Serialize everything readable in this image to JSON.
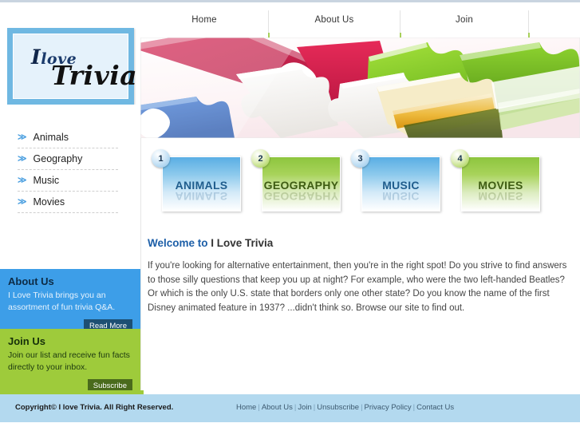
{
  "nav": {
    "items": [
      {
        "label": "Home"
      },
      {
        "label": "About Us"
      },
      {
        "label": "Join"
      }
    ]
  },
  "logo": {
    "line1_i": "I",
    "line1_love": "love",
    "line2": "Trivia"
  },
  "sidebar": {
    "menu": [
      {
        "label": "Animals",
        "bullet": "≫"
      },
      {
        "label": "Geography",
        "bullet": "≫"
      },
      {
        "label": "Music",
        "bullet": "≫"
      },
      {
        "label": "Movies",
        "bullet": "≫"
      }
    ],
    "about": {
      "title": "About Us",
      "text": "I Love Trivia brings you an assortment of fun trivia Q&A.",
      "button": "Read More"
    },
    "join": {
      "title": "Join Us",
      "text": "Join our list and receive fun facts directly to your inbox.",
      "button": "Subscribe"
    }
  },
  "cards": [
    {
      "number": "1",
      "label": "ANIMALS",
      "color": "blue"
    },
    {
      "number": "2",
      "label": "GEOGRAPHY",
      "color": "green"
    },
    {
      "number": "3",
      "label": "MUSIC",
      "color": "blue"
    },
    {
      "number": "4",
      "label": "MOVIES",
      "color": "green"
    }
  ],
  "welcome": {
    "heading_accent": "Welcome to ",
    "heading_rest": "I Love Trivia",
    "body": "If you're looking for alternative entertainment, then you're in the right spot! Do you strive to find answers to those silly questions that keep you up at night? For example, who were the two left-handed Beatles? Or which is the only U.S. state that borders only one other state? Do you know the name of the first Disney animated feature in 1937? ...didn't think so. Browse our site to find out."
  },
  "footer": {
    "copyright": "Copyright© I love Trivia. All Right Reserved.",
    "links": [
      "Home",
      "About Us",
      "Join",
      "Unsubscribe",
      "Privacy Policy",
      "Contact Us"
    ]
  },
  "colors": {
    "accent_blue": "#3d9ee8",
    "accent_green": "#9ecb3b",
    "footer_blue": "#b3d9ef",
    "logo_border": "#6fb8e2",
    "heading_blue": "#1d5fa8"
  }
}
